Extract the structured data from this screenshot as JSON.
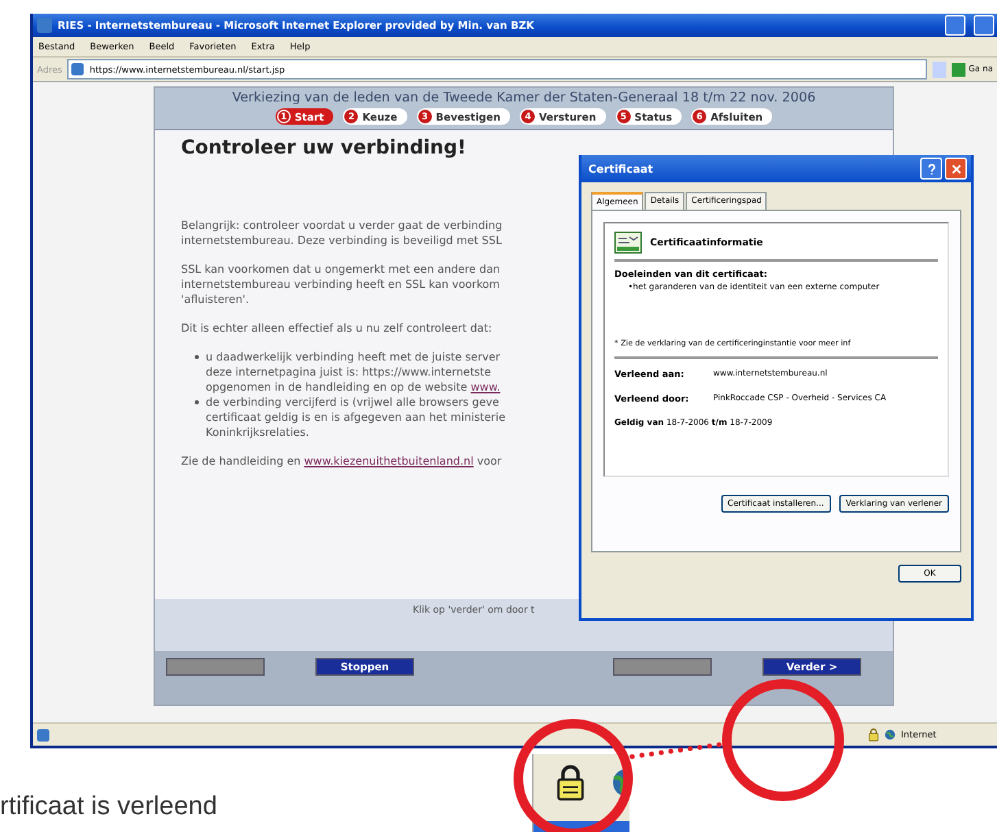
{
  "window": {
    "title": "RIES - Internetstembureau - Microsoft Internet Explorer provided by Min. van BZK"
  },
  "menu": [
    "Bestand",
    "Bewerken",
    "Beeld",
    "Favorieten",
    "Extra",
    "Help"
  ],
  "address_bar": {
    "label": "Adres",
    "url": "https://www.internetstembureau.nl/start.jsp",
    "go_label": "Ga na"
  },
  "page": {
    "header": {
      "title": "Verkiezing van de leden van de Tweede Kamer der Staten-Generaal 18 t/m 22 nov. 2006",
      "steps": [
        {
          "number": "1",
          "label": "Start",
          "selected": true
        },
        {
          "number": "2",
          "label": "Keuze",
          "selected": false
        },
        {
          "number": "3",
          "label": "Bevestigen",
          "selected": false
        },
        {
          "number": "4",
          "label": "Versturen",
          "selected": false
        },
        {
          "number": "5",
          "label": "Status",
          "selected": false
        },
        {
          "number": "6",
          "label": "Afsluiten",
          "selected": false
        }
      ]
    },
    "heading": "Controleer uw verbinding!",
    "paragraphs": [
      {
        "kind": "text",
        "lines": [
          {
            "text": "Belangrijk: controleer voordat u verder gaat de verbinding"
          },
          {
            "text": "internetstembureau. Deze verbinding is beveiligd met SSL"
          }
        ]
      },
      {
        "kind": "text",
        "lines": [
          {
            "text": "SSL kan voorkomen dat u ongemerkt met een andere dan"
          },
          {
            "text": "internetstembureau verbinding heeft en SSL kan voorkom"
          },
          {
            "text": "'afluisteren'."
          }
        ]
      },
      {
        "kind": "text",
        "lines": [
          {
            "text": "Dit is echter alleen effectief als u nu zelf controleert dat:"
          }
        ]
      },
      {
        "kind": "bullets",
        "items": [
          [
            {
              "text": "u daadwerkelijk verbinding heeft met de juiste server"
            },
            {
              "text": "deze internetpagina juist is: https://www.internetste"
            },
            {
              "text": "opgenomen in de handleiding en op de website ",
              "link": "www."
            }
          ],
          [
            {
              "text": "de verbinding vercijferd is (vrijwel alle browsers geve"
            },
            {
              "text": "certificaat geldig is en is afgegeven aan het ministerie"
            },
            {
              "text": "Koninkrijksrelaties."
            }
          ]
        ]
      },
      {
        "kind": "text",
        "lines": [
          {
            "text": "Zie de handleiding en ",
            "link": "www.kiezenuithetbuitenland.nl",
            "after": " voor"
          }
        ]
      }
    ],
    "footer_note": "Klik op 'verder' om door t",
    "footer_buttons": [
      {
        "disabled": true
      },
      {
        "label": "Stoppen",
        "disabled": false
      },
      {
        "disabled": true
      },
      {
        "label": "Verder >",
        "disabled": false
      }
    ]
  },
  "status_bar": {
    "zone": "Internet"
  },
  "dialog": {
    "title": "Certificaat",
    "tabs": [
      {
        "label": "Algemeen",
        "selected": true
      },
      {
        "label": "Details",
        "selected": false
      },
      {
        "label": "Certificeringspad",
        "selected": false
      }
    ],
    "info_title": "Certificaatinformatie",
    "purpose_heading": "Doeleinden van dit certificaat:",
    "purposes": [
      "•het garanderen van de identiteit van een externe computer"
    ],
    "note": "* Zie de verklaring van de certificeringinstantie voor meer inf",
    "fields": [
      {
        "label": "Verleend aan:",
        "value": "www.internetstembureau.nl"
      },
      {
        "label": "Verleend door:",
        "value": "PinkRoccade CSP - Overheid - Services CA"
      }
    ],
    "validity": "**Geldig van** 18-7-2006 **t/m** 18-7-2009",
    "buttons": [
      "Certificaat installeren...",
      "Verklaring van verlener"
    ],
    "ok": "OK"
  },
  "caption": "rtificaat is verleend"
}
